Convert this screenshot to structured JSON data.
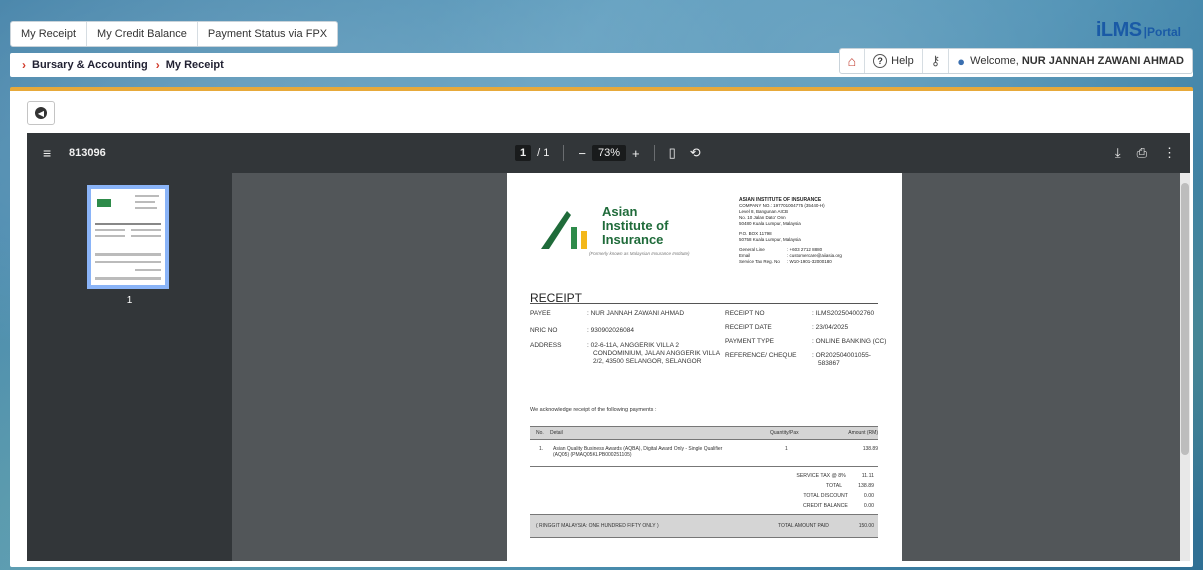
{
  "tabs": [
    "My Receipt",
    "My Credit Balance",
    "Payment Status via FPX"
  ],
  "breadcrumb": [
    "Bursary & Accounting",
    "My Receipt"
  ],
  "logo": {
    "main": "iLMS",
    "sub": "|Portal"
  },
  "userbar": {
    "help_label": "Help",
    "welcome_prefix": "Welcome,",
    "user_name": "NUR JANNAH ZAWANI AHMAD"
  },
  "viewer": {
    "doc_title": "813096",
    "page_current": "1",
    "page_total": "/ 1",
    "zoom": "73%",
    "zoom_minus": "−",
    "zoom_plus": "+",
    "thumb_label": "1"
  },
  "receipt": {
    "logo_line1": "Asian",
    "logo_line2": "Institute of",
    "logo_line3": "Insurance",
    "logo_tag": "(Formerly known as Malaysian Insurance Institute)",
    "company_name": "ASIAN INSTITUTE OF INSURANCE",
    "company_no": "COMPANY NO.: 197701004775 (35440-H)",
    "addr1": "Level 8, Bangunan AICB",
    "addr2": "No. 10 Jalan Dato' Onn",
    "addr3": "50480 Kuala Lumpur, Malaysia",
    "po1": "P.O. BOX 11798",
    "po2": "50758 Kuala Lumpur, Malaysia",
    "gen_label": "General Line",
    "gen_value": ": +603 2712 8880",
    "email_label": "Email",
    "email_value": ": customercare@aiiasia.org",
    "tax_label": "Service Tax Reg. No",
    "tax_value": ": W10-1901-32000180",
    "title": "RECEIPT",
    "payee_label": "PAYEE",
    "payee_value": ": NUR JANNAH ZAWANI AHMAD",
    "nric_label": "NRIC NO",
    "nric_value": ": 930902026084",
    "address_label": "ADDRESS",
    "address_value1": ": 02-6-11A, ANGGERIK VILLA 2",
    "address_value2": "CONDOMINIUM, JALAN ANGGERIK VILLA",
    "address_value3": "2/2, 43500 SELANGOR, SELANGOR",
    "receipt_no_label": "RECEIPT NO",
    "receipt_no_value": ": ILMS202504002760",
    "receipt_date_label": "RECEIPT DATE",
    "receipt_date_value": ": 23/04/2025",
    "payment_type_label": "PAYMENT TYPE",
    "payment_type_value": ": ONLINE BANKING (CC)",
    "ref_label": "REFERENCE/ CHEQUE",
    "ref_value1": ": OR202504001055-",
    "ref_value2": "583867",
    "ack": "We acknowledge receipt of the following payments :",
    "col_no": "No.",
    "col_detail": "Detail",
    "col_qty": "Quantity/Pax",
    "col_amount": "Amount (RM)",
    "item_no": "1.",
    "item_detail1": "Asian Quality Business Awards (AQBA), Digital Award Only - Single Qualifier",
    "item_detail2": "(AQ05) (PMAQ05KLPB000251105)",
    "item_qty": "1",
    "item_amount": "138.89",
    "service_tax_label": "SERVICE TAX @ 8%",
    "service_tax_value": "11.11",
    "total_label": "TOTAL",
    "total_value": "138.89",
    "discount_label": "TOTAL DISCOUNT",
    "discount_value": "0.00",
    "credit_label": "CREDIT BALANCE",
    "credit_value": "0.00",
    "words": "( RINGGIT MALAYSIA: ONE HUNDRED FIFTY ONLY )",
    "paid_label": "TOTAL AMOUNT PAID",
    "paid_value": "150.00"
  }
}
